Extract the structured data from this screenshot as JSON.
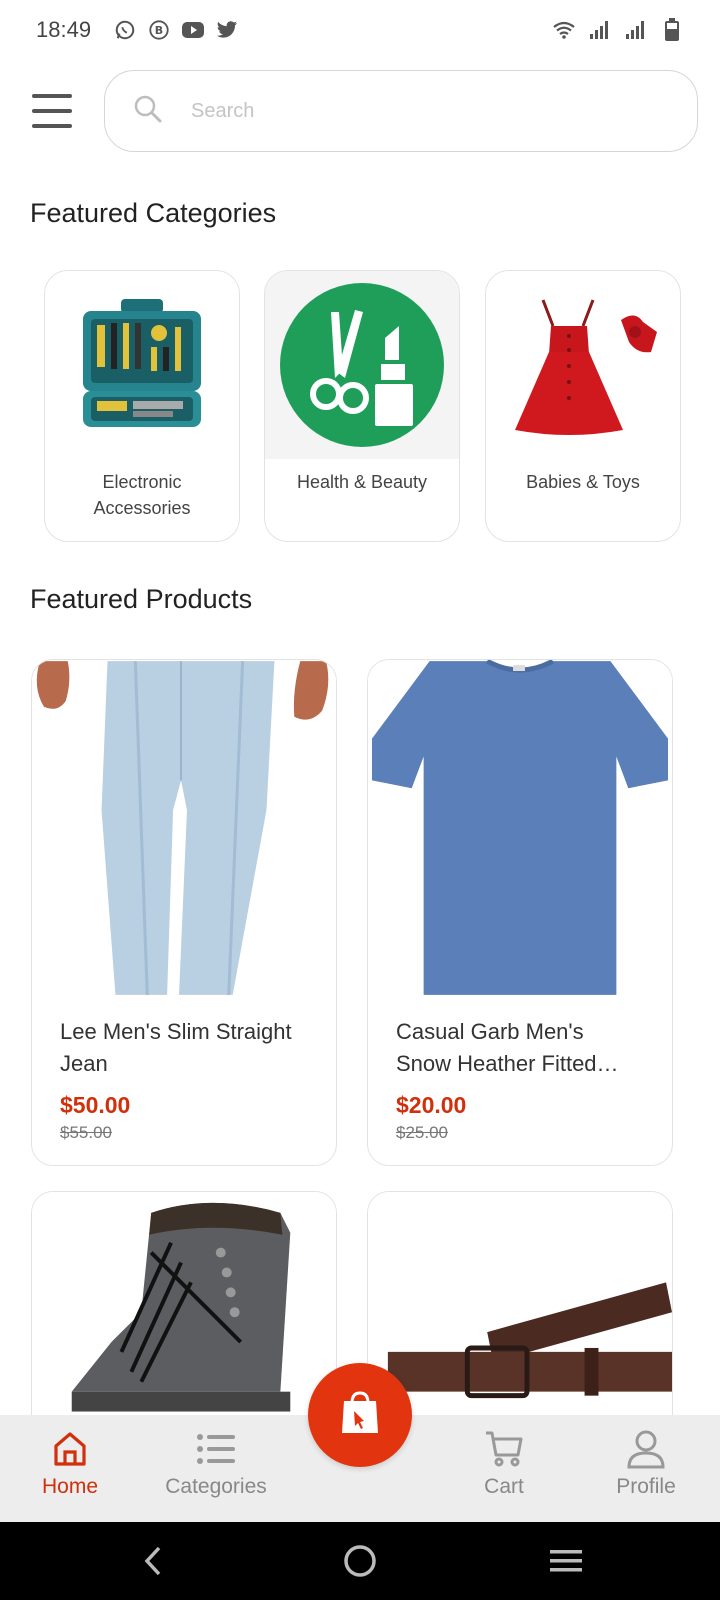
{
  "status_bar": {
    "time": "18:49",
    "left_icons": [
      "whatsapp-icon",
      "b-icon",
      "youtube-icon",
      "twitter-icon"
    ],
    "right_icons": [
      "wifi-icon",
      "signal-icon",
      "signal-icon",
      "battery-icon"
    ]
  },
  "search": {
    "placeholder": "Search"
  },
  "categories": {
    "title": "Featured Categories",
    "items": [
      {
        "label": "Electronic Accessories",
        "icon": "toolkit-icon"
      },
      {
        "label": "Health & Beauty",
        "icon": "scissors-lipstick-icon"
      },
      {
        "label": "Babies & Toys",
        "icon": "red-dress-icon"
      }
    ]
  },
  "products": {
    "title": "Featured Products",
    "items": [
      {
        "name": "Lee Men's Slim Straight Jean",
        "price": "$50.00",
        "old_price": "$55.00",
        "image": "jeans-icon"
      },
      {
        "name": "Casual Garb Men's Snow Heather Fitted…",
        "price": "$20.00",
        "old_price": "$25.00",
        "image": "tshirt-icon"
      },
      {
        "name": "",
        "price": "",
        "old_price": "",
        "image": "boot-icon"
      },
      {
        "name": "",
        "price": "",
        "old_price": "",
        "image": "belt-icon"
      }
    ]
  },
  "bottom_nav": {
    "items": [
      {
        "label": "Home",
        "icon": "home-icon",
        "active": true
      },
      {
        "label": "Categories",
        "icon": "list-icon",
        "active": false
      },
      {
        "label": "Cart",
        "icon": "cart-icon",
        "active": false
      },
      {
        "label": "Profile",
        "icon": "user-icon",
        "active": false
      }
    ],
    "fab_icon": "shopping-bag-icon"
  },
  "colors": {
    "accent": "#e2350f",
    "price": "#d0300b",
    "green": "#1f9e5a"
  }
}
